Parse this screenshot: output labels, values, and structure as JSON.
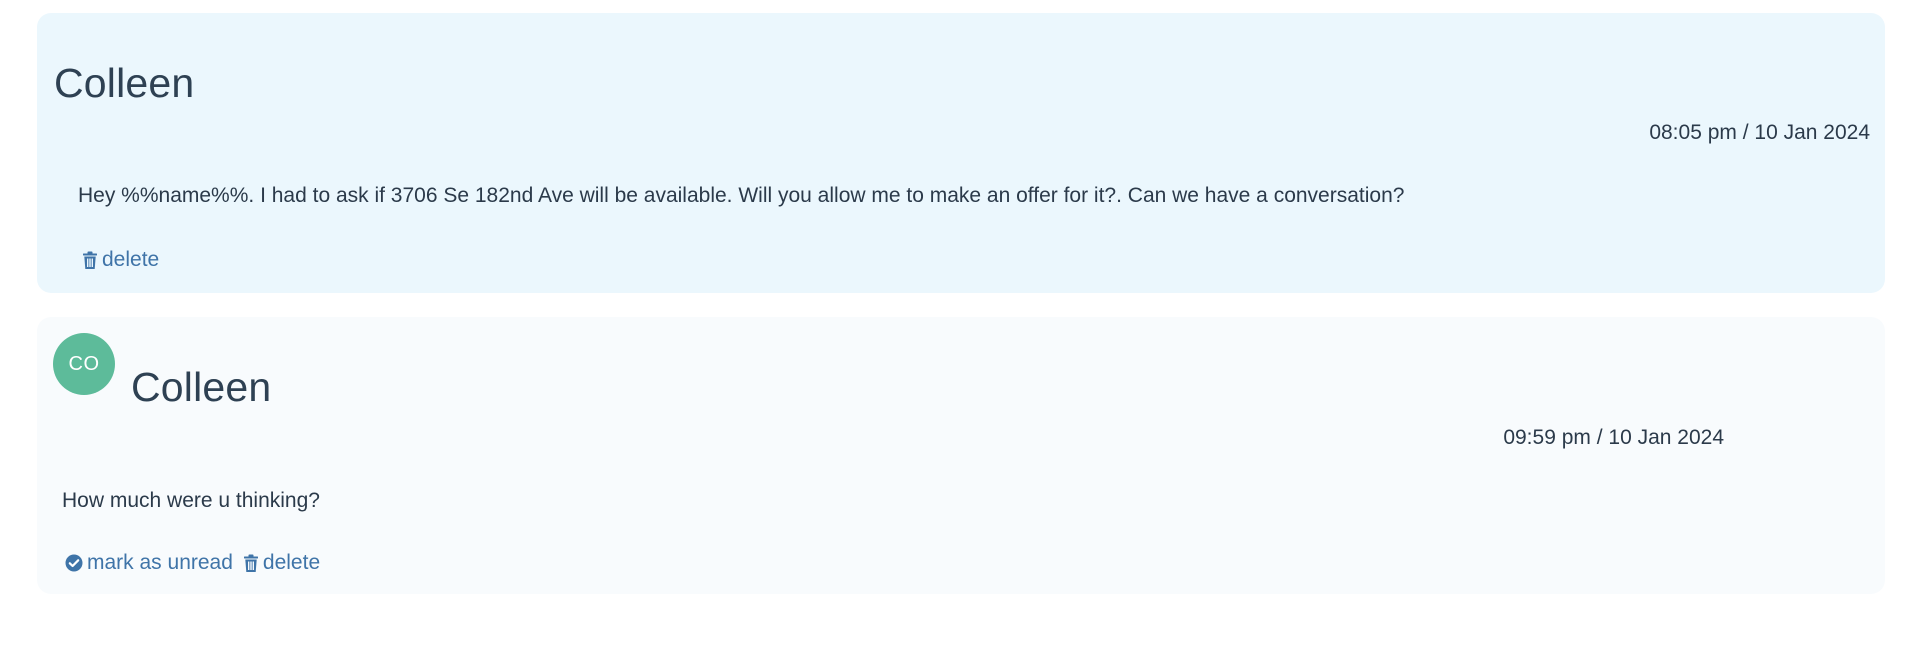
{
  "messages": [
    {
      "sender": "Colleen",
      "timestamp": "08:05 pm / 10 Jan 2024",
      "body": "Hey %%name%%. I had to ask if 3706 Se 182nd Ave will be available. Will you allow me to make an offer for it?. Can we have a conversation?",
      "actions": {
        "delete_label": "delete",
        "delete_icon": "trash-icon"
      }
    },
    {
      "avatar_initials": "CO",
      "sender": "Colleen",
      "timestamp": "09:59 pm / 10 Jan 2024",
      "body": "How much were u thinking?",
      "actions": {
        "mark_unread_label": "mark as unread",
        "mark_unread_icon": "check-circle-icon",
        "delete_label": "delete",
        "delete_icon": "trash-icon"
      }
    }
  ],
  "colors": {
    "card_incoming_bg": "#ebf7fd",
    "card_reply_bg": "#f8fbfd",
    "link": "#3f74a8",
    "avatar_bg": "#5dbb9a",
    "text": "#2b3a4a"
  }
}
